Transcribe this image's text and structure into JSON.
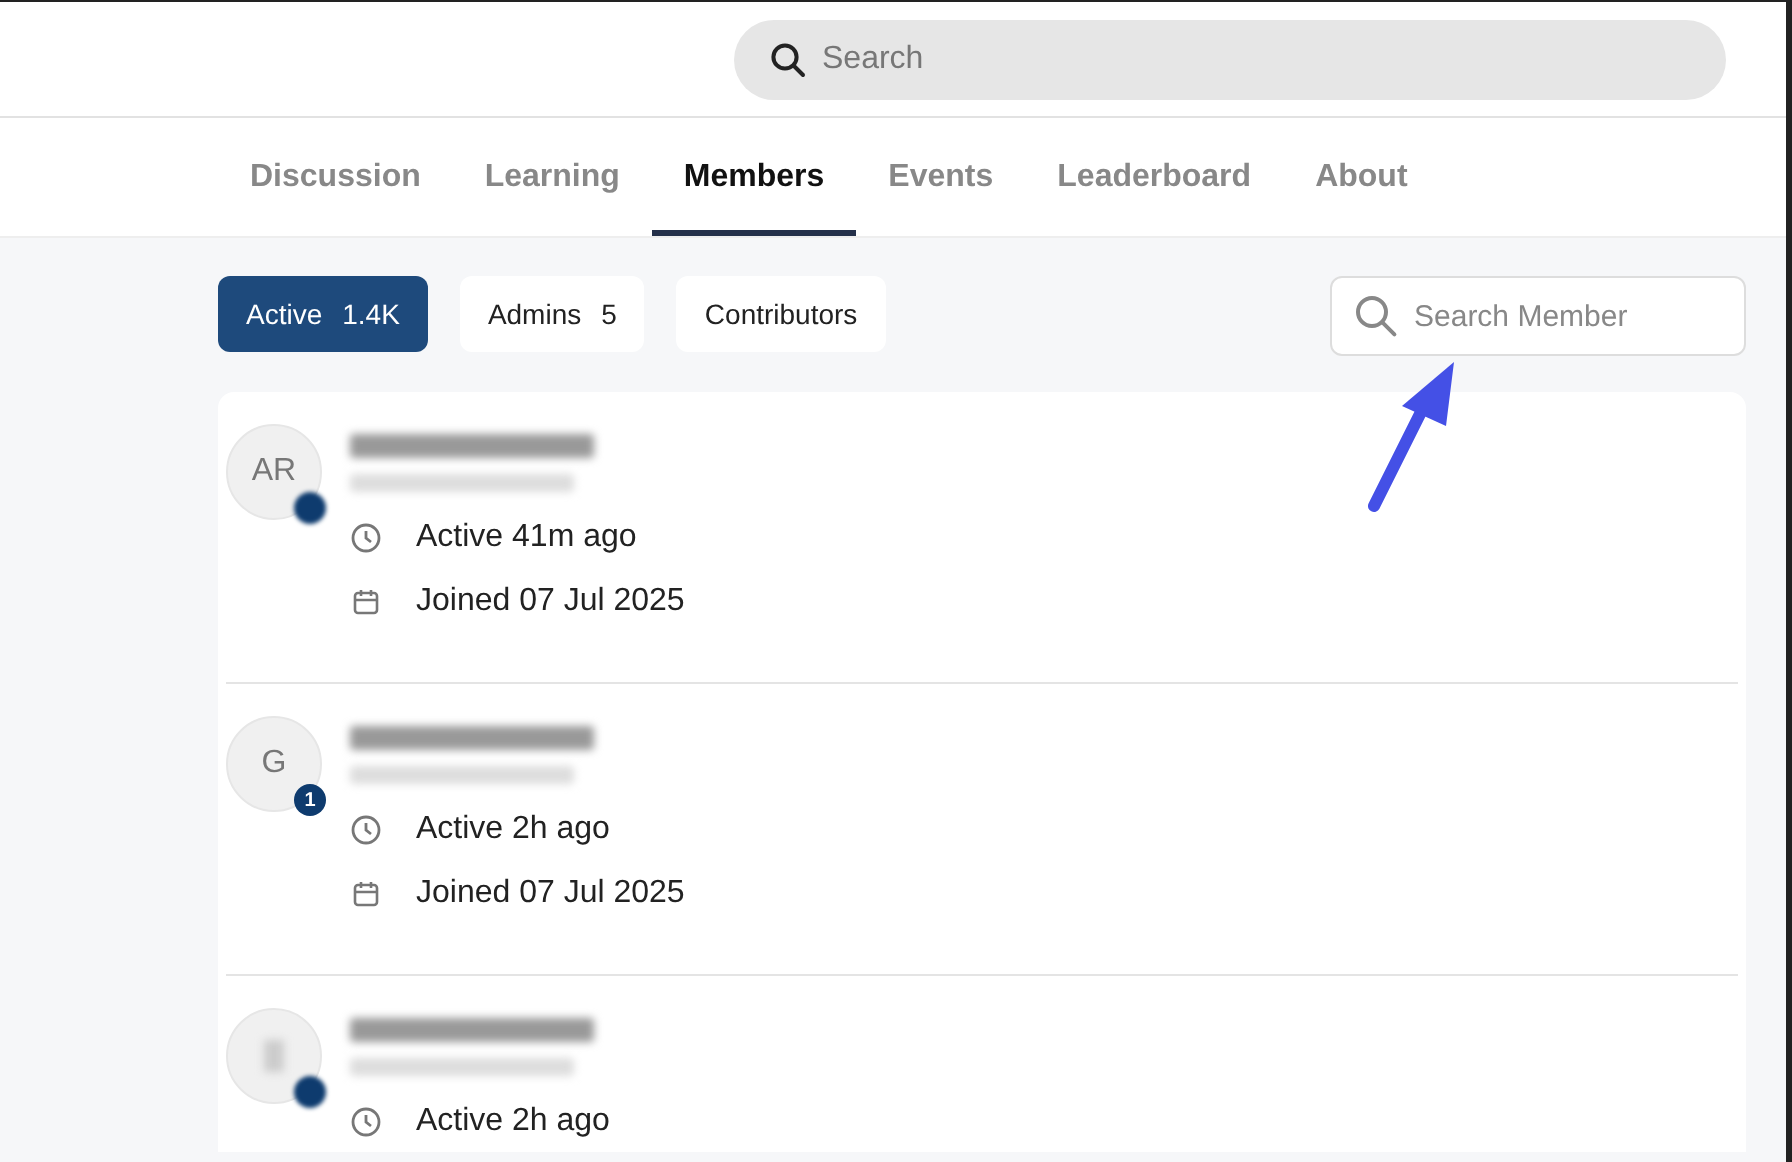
{
  "header": {
    "search": {
      "placeholder": "Search"
    }
  },
  "tabs": [
    {
      "label": "Discussion",
      "selected": false
    },
    {
      "label": "Learning",
      "selected": false
    },
    {
      "label": "Members",
      "selected": true
    },
    {
      "label": "Events",
      "selected": false
    },
    {
      "label": "Leaderboard",
      "selected": false
    },
    {
      "label": "About",
      "selected": false
    }
  ],
  "filters": [
    {
      "label": "Active",
      "count": "1.4K",
      "selected": true
    },
    {
      "label": "Admins",
      "count": "5",
      "selected": false
    },
    {
      "label": "Contributors",
      "selected": false
    }
  ],
  "member_search": {
    "placeholder": "Search Member"
  },
  "members": [
    {
      "initials": "AR",
      "active": "Active 41m ago",
      "joined": "Joined 07 Jul 2025"
    },
    {
      "initials": "G",
      "badge": "1",
      "active": "Active 2h ago",
      "joined": "Joined 07 Jul 2025"
    },
    {
      "active": "Active 2h ago"
    }
  ]
}
